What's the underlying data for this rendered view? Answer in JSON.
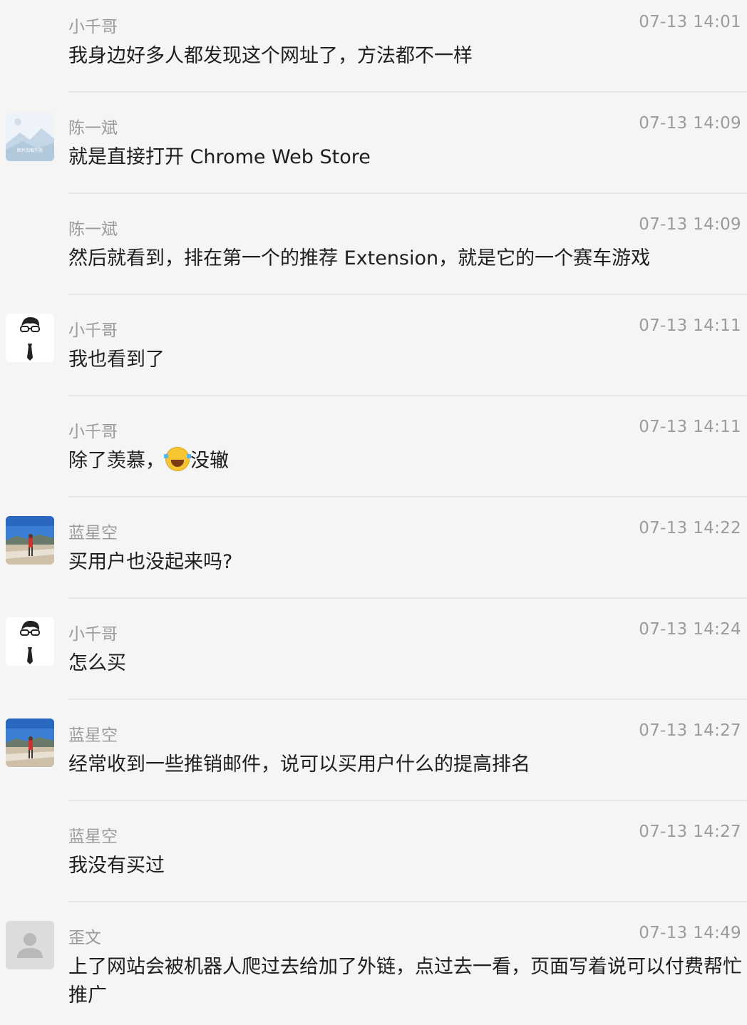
{
  "messages": [
    {
      "sender": "小千哥",
      "time": "07-13 14:01",
      "text": "我身边好多人都发现这个网址了，方法都不一样",
      "avatar": "none"
    },
    {
      "sender": "陈一斌",
      "time": "07-13 14:09",
      "text": "就是直接打开 Chrome Web Store",
      "avatar": "landscape-placeholder"
    },
    {
      "sender": "陈一斌",
      "time": "07-13 14:09",
      "text": "然后就看到，排在第一个的推荐 Extension，就是它的一个赛车游戏",
      "avatar": "none"
    },
    {
      "sender": "小千哥",
      "time": "07-13 14:11",
      "text": "我也看到了",
      "avatar": "cartoon-man-glasses"
    },
    {
      "sender": "小千哥",
      "time": "07-13 14:11",
      "text_before": "除了羡慕，",
      "emoji": "tears-of-joy-emoji",
      "text_after": "没辙",
      "avatar": "none"
    },
    {
      "sender": "蓝星空",
      "time": "07-13 14:22",
      "text": "买用户也没起来吗?",
      "avatar": "road-photo"
    },
    {
      "sender": "小千哥",
      "time": "07-13 14:24",
      "text": "怎么买",
      "avatar": "cartoon-man-glasses"
    },
    {
      "sender": "蓝星空",
      "time": "07-13 14:27",
      "text": "经常收到一些推销邮件，说可以买用户什么的提高排名",
      "avatar": "road-photo"
    },
    {
      "sender": "蓝星空",
      "time": "07-13 14:27",
      "text": "我没有买过",
      "avatar": "none"
    },
    {
      "sender": "歪文",
      "time": "07-13 14:49",
      "text": "上了网站会被机器人爬过去给加了外链，点过去一看，页面写着说可以付费帮忙推广",
      "avatar": "default-user"
    }
  ],
  "avatar_caption": "图片加载失败"
}
